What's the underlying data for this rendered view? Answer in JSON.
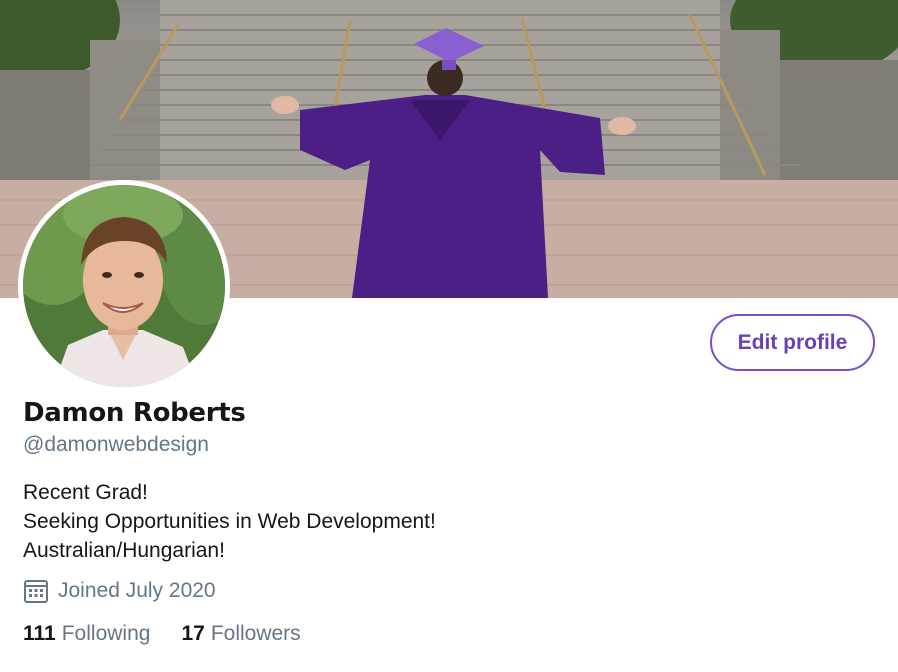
{
  "profile": {
    "name": "Damon Roberts",
    "handle": "@damonwebdesign",
    "bio": [
      "Recent Grad!",
      "Seeking Opportunities in Web Development!",
      "Australian/Hungarian!"
    ],
    "joined": "Joined July 2020",
    "following_count": "111",
    "following_label": "Following",
    "followers_count": "17",
    "followers_label": "Followers"
  },
  "actions": {
    "edit_profile_label": "Edit profile"
  },
  "icons": {
    "joined": "calendar-icon"
  },
  "colors": {
    "accent": "#7b4fc6",
    "text_primary": "#14171a",
    "text_secondary": "#657786"
  }
}
